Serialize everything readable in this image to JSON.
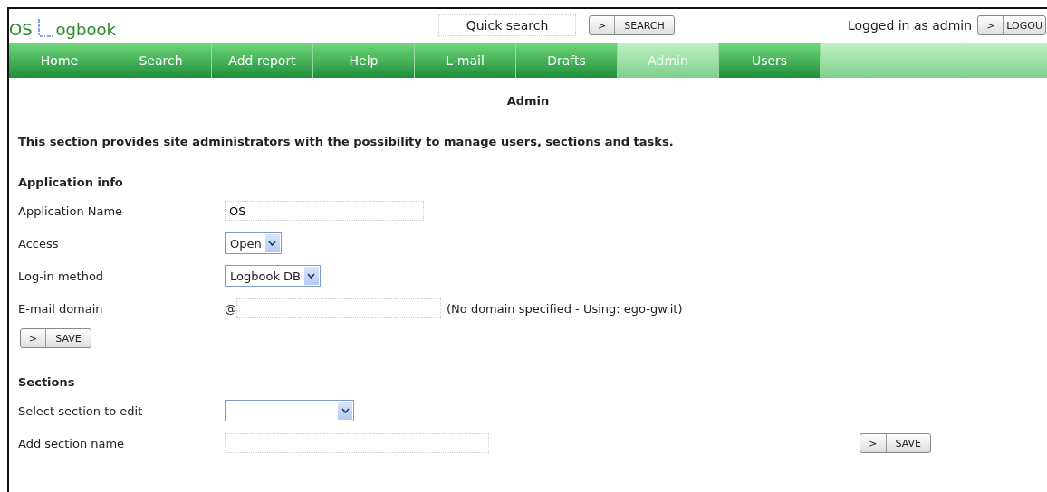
{
  "header": {
    "logo_left": "OS",
    "logo_right": "ogbook",
    "quick_search": {
      "placeholder": "Quick search"
    },
    "search_button": {
      "arrow": ">",
      "label": "SEARCH"
    },
    "login_text": "Logged in as admin",
    "logout_button": {
      "arrow": ">",
      "label": "LOGOU"
    }
  },
  "nav": [
    {
      "label": "Home",
      "selected": false
    },
    {
      "label": "Search",
      "selected": false
    },
    {
      "label": "Add report",
      "selected": false
    },
    {
      "label": "Help",
      "selected": false
    },
    {
      "label": "L-mail",
      "selected": false
    },
    {
      "label": "Drafts",
      "selected": false
    },
    {
      "label": "Admin",
      "selected": true
    },
    {
      "label": "Users",
      "selected": false
    }
  ],
  "page_title": "Admin",
  "intro": "This section provides site administrators with the possibility to manage users, sections and tasks.",
  "application_info": {
    "heading": "Application info",
    "fields": [
      {
        "kind": "text",
        "label": "Application Name",
        "value": "OS"
      },
      {
        "kind": "select",
        "label": "Access",
        "value": "Open"
      },
      {
        "kind": "select",
        "label": "Log-in method",
        "value": "Logbook DB"
      },
      {
        "kind": "email",
        "label": "E-mail domain",
        "prefix": "@",
        "note": "(No domain specified - Using: ego-gw.it)"
      }
    ],
    "save_button": {
      "arrow": ">",
      "label": "SAVE"
    }
  },
  "sections": {
    "heading": "Sections",
    "select_label": "Select section to edit",
    "add_label": "Add section name",
    "save_button": {
      "arrow": ">",
      "label": "SAVE"
    }
  }
}
